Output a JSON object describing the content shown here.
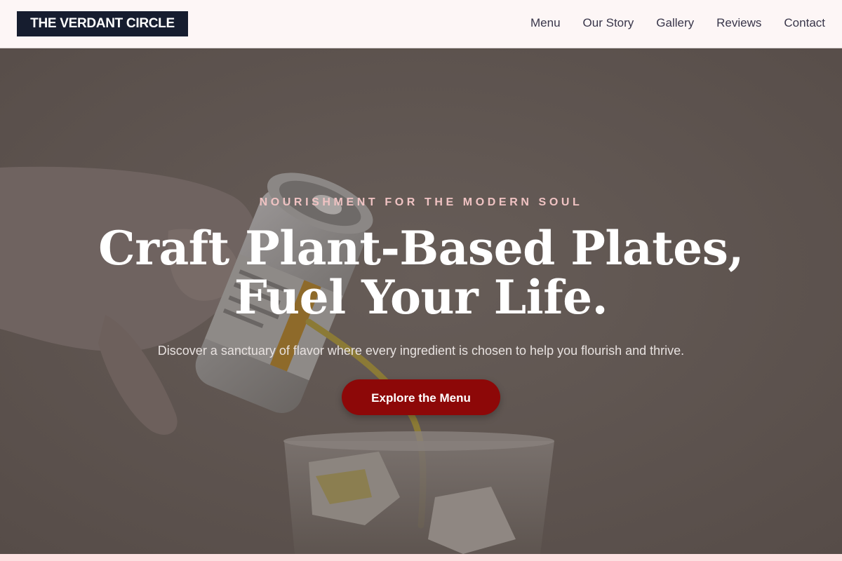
{
  "brand": {
    "name": "THE VERDANT CIRCLE"
  },
  "nav": {
    "items": [
      "Menu",
      "Our Story",
      "Gallery",
      "Reviews",
      "Contact"
    ]
  },
  "hero": {
    "eyebrow": "NOURISHMENT FOR THE MODERN SOUL",
    "headline_line1": "Craft Plant-Based Plates,",
    "headline_line2": "Fuel Your Life.",
    "subtext": "Discover a sanctuary of flavor where every ingredient is chosen to help you flourish and thrive.",
    "cta_label": "Explore the Menu",
    "background_image_subject": "hand pouring a can into a glass with ice"
  },
  "colors": {
    "header_bg": "#fdf6f6",
    "logo_bg": "#161d2f",
    "cta_bg": "#8d0808",
    "eyebrow": "#f0c3c3",
    "bottom_strip": "#fde0e1"
  }
}
